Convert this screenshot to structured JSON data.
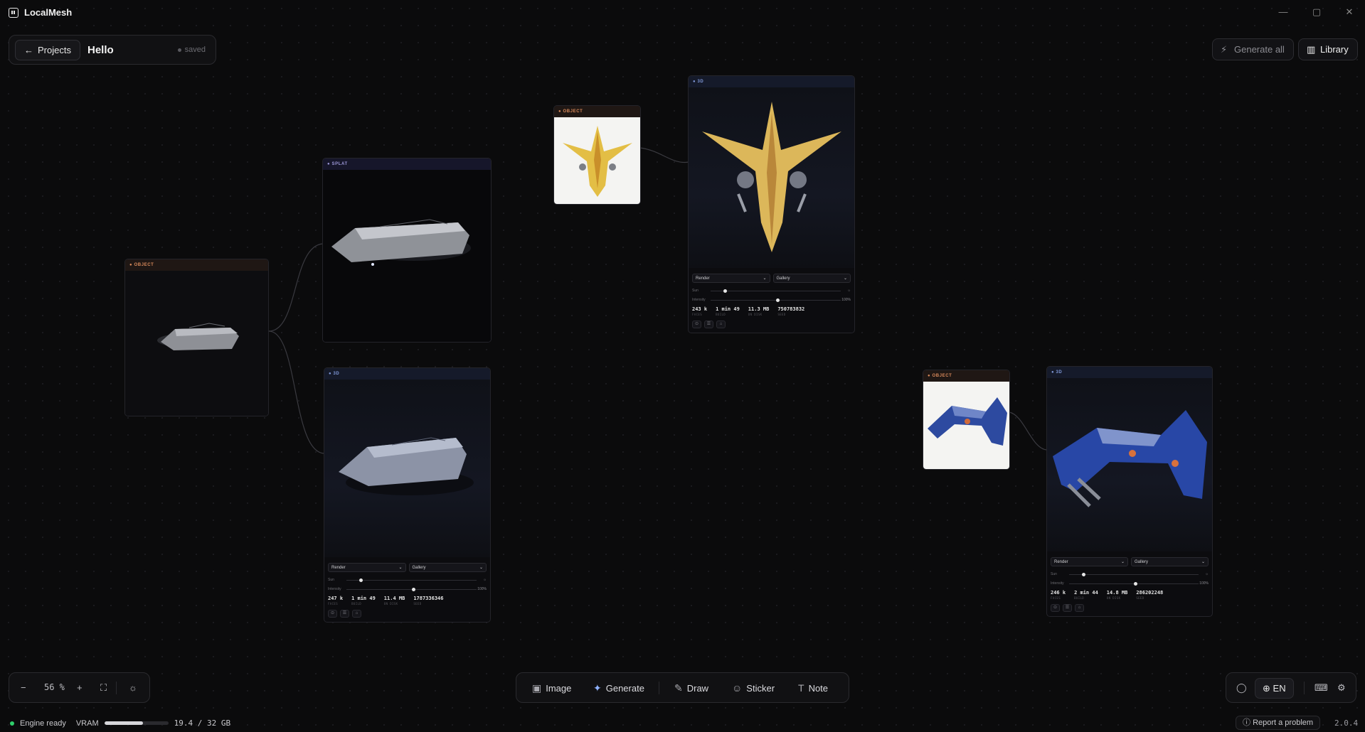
{
  "app": {
    "title": "LocalMesh"
  },
  "window_controls": {
    "minimize": "—",
    "maximize": "▢",
    "close": "✕"
  },
  "project": {
    "back_label": "Projects",
    "name": "Hello",
    "save_state": "saved"
  },
  "top_actions": {
    "generate_all": "Generate all",
    "library": "Library"
  },
  "nodes": [
    {
      "type": "OBJECT",
      "tone": "dark"
    },
    {
      "type": "SPLAT"
    },
    {
      "type": "3D",
      "controls": {
        "render": "Render",
        "gallery": "Gallery",
        "sun_label": "Sun",
        "intensity_label": "Intensity",
        "intensity_value": "100%",
        "sun_level": 0.1,
        "intensity_level": 0.5,
        "faces": "247 k",
        "faces_label": "FACES",
        "build": "1 min 49",
        "build_label": "BUILD",
        "size": "11.4 MB",
        "size_label": "ON DISK",
        "seed": "1787336346",
        "seed_label": "SEED"
      }
    },
    {
      "type": "OBJECT",
      "tone": "light"
    },
    {
      "type": "3D",
      "controls": {
        "render": "Render",
        "gallery": "Gallery",
        "sun_label": "Sun",
        "intensity_label": "Intensity",
        "intensity_value": "100%",
        "sun_level": 0.1,
        "intensity_level": 0.5,
        "faces": "243 k",
        "faces_label": "FACES",
        "build": "1 min 49",
        "build_label": "BUILD",
        "size": "11.3 MB",
        "size_label": "ON DISK",
        "seed": "750783832",
        "seed_label": "SEED"
      }
    },
    {
      "type": "OBJECT",
      "tone": "light"
    },
    {
      "type": "3D",
      "controls": {
        "render": "Render",
        "gallery": "Gallery",
        "sun_label": "Sun",
        "intensity_label": "Intensity",
        "intensity_value": "100%",
        "sun_level": 0.1,
        "intensity_level": 0.5,
        "faces": "246 k",
        "faces_label": "FACES",
        "build": "2 min 44",
        "build_label": "BUILD",
        "size": "14.8 MB",
        "size_label": "ON DISK",
        "seed": "286202248",
        "seed_label": "SEED"
      }
    }
  ],
  "zoom": {
    "minus": "−",
    "value": "56 %",
    "plus": "+",
    "fit": "⛶",
    "theme": "☼"
  },
  "toolbar": {
    "image": "Image",
    "generate": "Generate",
    "draw": "Draw",
    "sticker": "Sticker",
    "note": "Note"
  },
  "settings_bar": {
    "language": "EN"
  },
  "status": {
    "engine": "Engine ready",
    "vram_label": "VRAM",
    "vram_value": "19.4 / 32 GB",
    "vram_fraction": 0.606,
    "report": "Report a problem",
    "version": "2.0.4"
  },
  "colors": {
    "accent_green": "#2fce6b",
    "object_header": "#d98a5b",
    "splat_header": "#9d98d8",
    "threed_header": "#7f98d8"
  }
}
